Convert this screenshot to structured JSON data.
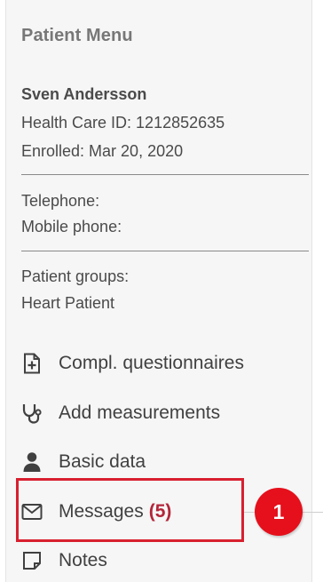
{
  "patient_menu": {
    "title": "Patient Menu",
    "patient": {
      "name": "Sven Andersson",
      "health_care_id": "Health Care ID: 1212852635",
      "enrolled": "Enrolled: Mar 20, 2020"
    },
    "contact": {
      "telephone_label": "Telephone:",
      "mobile_phone_label": "Mobile phone:"
    },
    "groups": {
      "label": "Patient groups:",
      "value": "Heart Patient"
    },
    "items": [
      {
        "label": "Compl. questionnaires",
        "icon": "questionnaire-icon"
      },
      {
        "label": "Add measurements",
        "icon": "stethoscope-icon"
      },
      {
        "label": "Basic data",
        "icon": "person-icon"
      },
      {
        "label": "Messages",
        "count": "(5)",
        "icon": "envelope-icon"
      },
      {
        "label": "Notes",
        "icon": "note-icon"
      }
    ]
  },
  "annotation": {
    "step_number": "1",
    "highlight_color": "#d81f2f",
    "badge_color": "#e5101b"
  },
  "colors": {
    "panel_background": "#f6f6f6",
    "count_color": "#b3263a"
  }
}
